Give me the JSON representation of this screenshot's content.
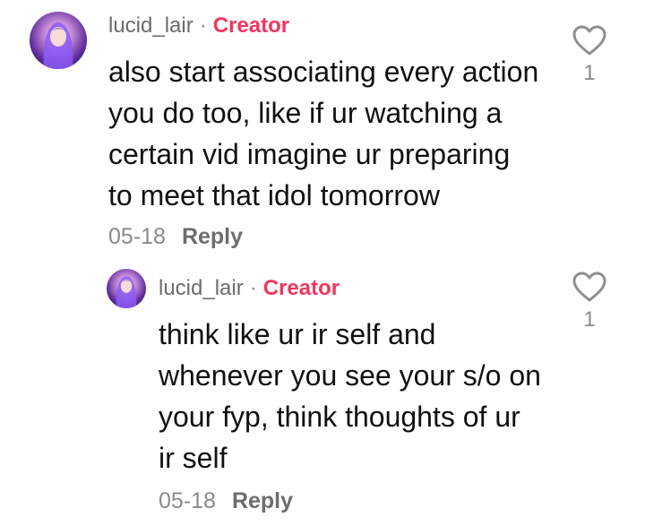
{
  "comments": [
    {
      "username": "lucid_lair",
      "role_badge": "Creator",
      "lines": [
        "also start associating every action",
        "you do too, like if ur watching a",
        "certain vid imagine ur preparing",
        "to meet that idol tomorrow"
      ],
      "date": "05-18",
      "reply_label": "Reply",
      "like_count": "1",
      "like_icon": "heart-outline-icon"
    },
    {
      "username": "lucid_lair",
      "role_badge": "Creator",
      "lines": [
        "think like ur ir self and",
        "whenever you see your s/o on",
        "your fyp, think thoughts of ur",
        "ir self"
      ],
      "date": "05-18",
      "reply_label": "Reply",
      "like_count": "1",
      "like_icon": "heart-outline-icon"
    }
  ],
  "colors": {
    "creator_badge": "#f0365f",
    "secondary_text": "#8a8a8a",
    "primary_text": "#111111"
  }
}
